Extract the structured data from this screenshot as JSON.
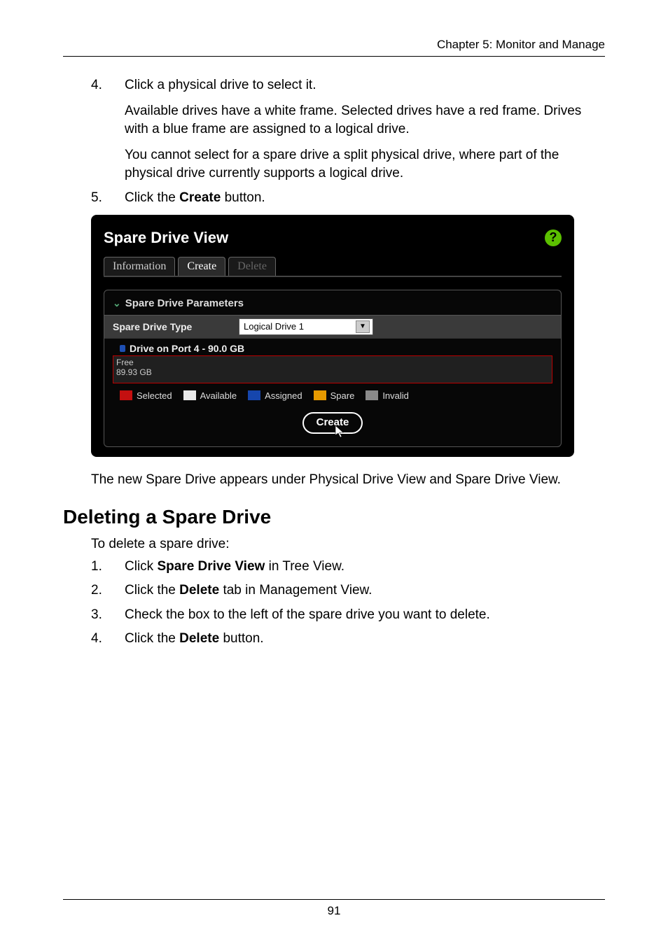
{
  "running_head": "Chapter 5: Monitor and Manage",
  "page_number": "91",
  "steps_a": [
    {
      "num": "4.",
      "paras": [
        "Click a physical drive to select it.",
        "Available drives have a white frame. Selected drives have a red frame. Drives with a blue frame are assigned to a logical drive.",
        "You cannot select for a spare drive a split physical drive, where part of the physical drive currently supports a logical drive."
      ]
    },
    {
      "num": "5.",
      "paras": [
        "Click the <b>Create</b> button."
      ]
    }
  ],
  "screenshot": {
    "title": "Spare Drive View",
    "help": "?",
    "tabs": {
      "info": "Information",
      "create": "Create",
      "delete": "Delete"
    },
    "panel_head": "Spare Drive Parameters",
    "param_label": "Spare Drive Type",
    "combo_value": "Logical Drive 1",
    "port_caption": "Drive on Port 4 - 90.0 GB",
    "free_line1": "Free",
    "free_line2": "89.93 GB",
    "legend": {
      "selected": "Selected",
      "available": "Available",
      "assigned": "Assigned",
      "spare": "Spare",
      "invalid": "Invalid"
    },
    "create_btn": "Create"
  },
  "caption_after": "The new Spare Drive appears under Physical Drive View and Spare Drive View.",
  "section_heading": "Deleting a Spare Drive",
  "delete_intro": "To delete a spare drive:",
  "steps_b": [
    {
      "num": "1.",
      "paras": [
        "Click <b>Spare Drive View</b> in Tree View."
      ]
    },
    {
      "num": "2.",
      "paras": [
        "Click the <b>Delete</b> tab in Management View."
      ]
    },
    {
      "num": "3.",
      "paras": [
        "Check the box to the left of the spare drive you want to delete."
      ]
    },
    {
      "num": "4.",
      "paras": [
        "Click the <b>Delete</b> button."
      ]
    }
  ]
}
